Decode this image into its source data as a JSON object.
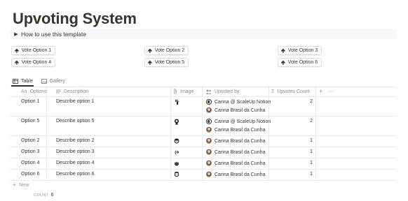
{
  "page": {
    "title": "Upvoting System"
  },
  "toggle": {
    "label": "How to use this template",
    "icon": "triangle-right-icon"
  },
  "vote_buttons": [
    {
      "label": "Vote Option 1",
      "icon": "arrow-up-icon"
    },
    {
      "label": "Vote Option 2",
      "icon": "arrow-up-icon"
    },
    {
      "label": "Vote Option 3",
      "icon": "arrow-up-icon"
    },
    {
      "label": "Vote Option 4",
      "icon": "arrow-up-icon"
    },
    {
      "label": "Vote Option 5",
      "icon": "arrow-up-icon"
    },
    {
      "label": "Vote Option 6",
      "icon": "arrow-up-icon"
    }
  ],
  "views": [
    {
      "label": "Table",
      "icon": "table-icon",
      "active": true
    },
    {
      "label": "Gallery",
      "icon": "gallery-icon",
      "active": false
    }
  ],
  "columns": [
    {
      "label": "Options",
      "icon": "Aa"
    },
    {
      "label": "Description",
      "icon": "text-lines-icon"
    },
    {
      "label": "Image",
      "icon": "paperclip-icon"
    },
    {
      "label": "Upvoted by",
      "icon": "people-icon"
    },
    {
      "label": "Upvotes Count",
      "icon": "sigma-icon"
    }
  ],
  "header_actions": {
    "add": "+",
    "more": "···"
  },
  "rows": [
    {
      "option": "Option 1",
      "description": "Describe option 1",
      "upvoted_by": [
        "Carina @ ScaleUp Notion",
        "Carina Brasil da Cunha"
      ],
      "count": "2"
    },
    {
      "option": "Option 5",
      "description": "Describe option 5",
      "upvoted_by": [
        "Carina @ ScaleUp Notion",
        "Carina Brasil da Cunha"
      ],
      "count": "2"
    },
    {
      "option": "Option 2",
      "description": "Describe option 2",
      "upvoted_by": [
        "Carina Brasil da Cunha"
      ],
      "count": "1"
    },
    {
      "option": "Option 3",
      "description": "Describe option 3",
      "upvoted_by": [
        "Carina Brasil da Cunha"
      ],
      "count": "1"
    },
    {
      "option": "Option 4",
      "description": "Describe option 4",
      "upvoted_by": [
        "Carina Brasil da Cunha"
      ],
      "count": "1"
    },
    {
      "option": "Option 6",
      "description": "Describe option 6",
      "upvoted_by": [
        "Carina Brasil da Cunha"
      ],
      "count": "1"
    }
  ],
  "new_row": {
    "label": "New"
  },
  "footer": {
    "count_label": "COUNT",
    "count_value": "6"
  }
}
